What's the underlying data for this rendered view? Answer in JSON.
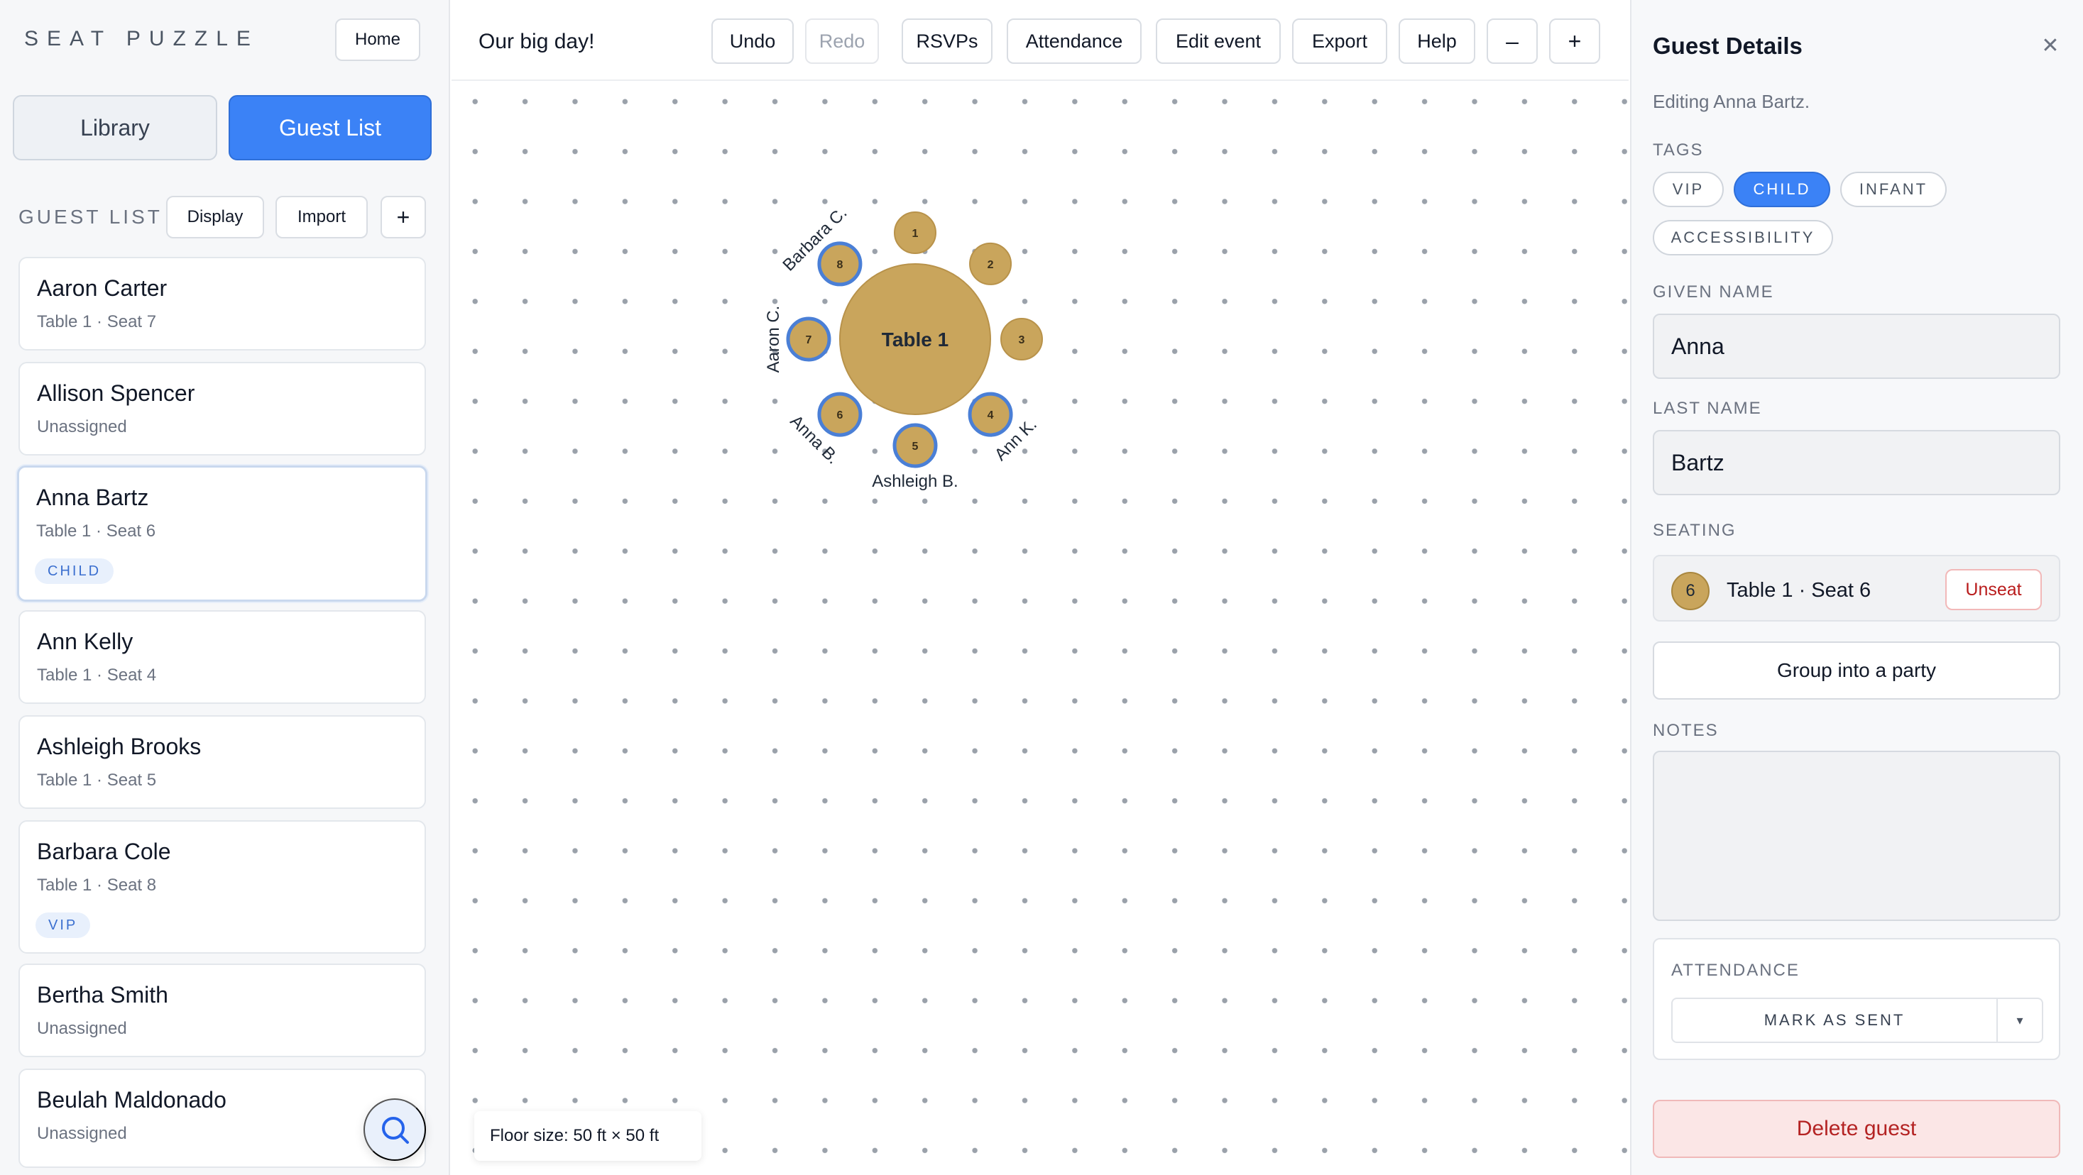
{
  "sidebar": {
    "brand": "SEAT PUZZLE",
    "home_label": "Home",
    "tabs": {
      "library": "Library",
      "guest_list": "Guest List"
    },
    "section_title": "GUEST LIST",
    "display_label": "Display",
    "import_label": "Import",
    "add_label": "+",
    "guests": [
      {
        "name": "Aaron Carter",
        "seat": "Table 1 · Seat 7",
        "badge": ""
      },
      {
        "name": "Allison Spencer",
        "seat": "Unassigned",
        "badge": ""
      },
      {
        "name": "Anna Bartz",
        "seat": "Table 1 · Seat 6",
        "badge": "CHILD"
      },
      {
        "name": "Ann Kelly",
        "seat": "Table 1 · Seat 4",
        "badge": ""
      },
      {
        "name": "Ashleigh Brooks",
        "seat": "Table 1 · Seat 5",
        "badge": ""
      },
      {
        "name": "Barbara Cole",
        "seat": "Table 1 · Seat 8",
        "badge": "VIP"
      },
      {
        "name": "Bertha Smith",
        "seat": "Unassigned",
        "badge": ""
      },
      {
        "name": "Beulah Maldonado",
        "seat": "Unassigned",
        "badge": ""
      }
    ],
    "search_icon": "search-icon"
  },
  "toolbar": {
    "event_title": "Our big day!",
    "undo": "Undo",
    "redo": "Redo",
    "rsvps": "RSVPs",
    "attendance": "Attendance",
    "edit_event": "Edit event",
    "export": "Export",
    "help": "Help",
    "zoom_out": "–",
    "zoom_in": "+"
  },
  "floor": {
    "size_label": "Floor size: 50 ft × 50 ft",
    "table": {
      "name": "Table 1",
      "seats": [
        {
          "number": "1",
          "occupied": false,
          "guest": ""
        },
        {
          "number": "2",
          "occupied": false,
          "guest": ""
        },
        {
          "number": "3",
          "occupied": false,
          "guest": ""
        },
        {
          "number": "4",
          "occupied": true,
          "guest": "Ann K."
        },
        {
          "number": "5",
          "occupied": true,
          "guest": "Ashleigh B."
        },
        {
          "number": "6",
          "occupied": true,
          "guest": "Anna B."
        },
        {
          "number": "7",
          "occupied": true,
          "guest": "Aaron C."
        },
        {
          "number": "8",
          "occupied": true,
          "guest": "Barbara C."
        }
      ]
    }
  },
  "details": {
    "title": "Guest Details",
    "subtitle": "Editing Anna Bartz.",
    "tags_label": "TAGS",
    "tags": [
      {
        "label": "VIP",
        "active": false
      },
      {
        "label": "CHILD",
        "active": true
      },
      {
        "label": "INFANT",
        "active": false
      },
      {
        "label": "ACCESSIBILITY",
        "active": false
      }
    ],
    "given_name_label": "GIVEN NAME",
    "given_name": "Anna",
    "last_name_label": "LAST NAME",
    "last_name": "Bartz",
    "seating_label": "SEATING",
    "seat_number": "6",
    "seat_text": "Table 1 · Seat 6",
    "unseat_label": "Unseat",
    "group_label": "Group into a party",
    "notes_label": "NOTES",
    "notes": "",
    "attendance_label": "ATTENDANCE",
    "attendance_action": "MARK AS SENT",
    "attendance_caret": "▾",
    "delete_label": "Delete guest"
  },
  "colors": {
    "accent": "#3b82f6",
    "seat_gold": "#c9a55c",
    "occupied_ring": "#4a7fd6",
    "danger": "#b42323"
  }
}
